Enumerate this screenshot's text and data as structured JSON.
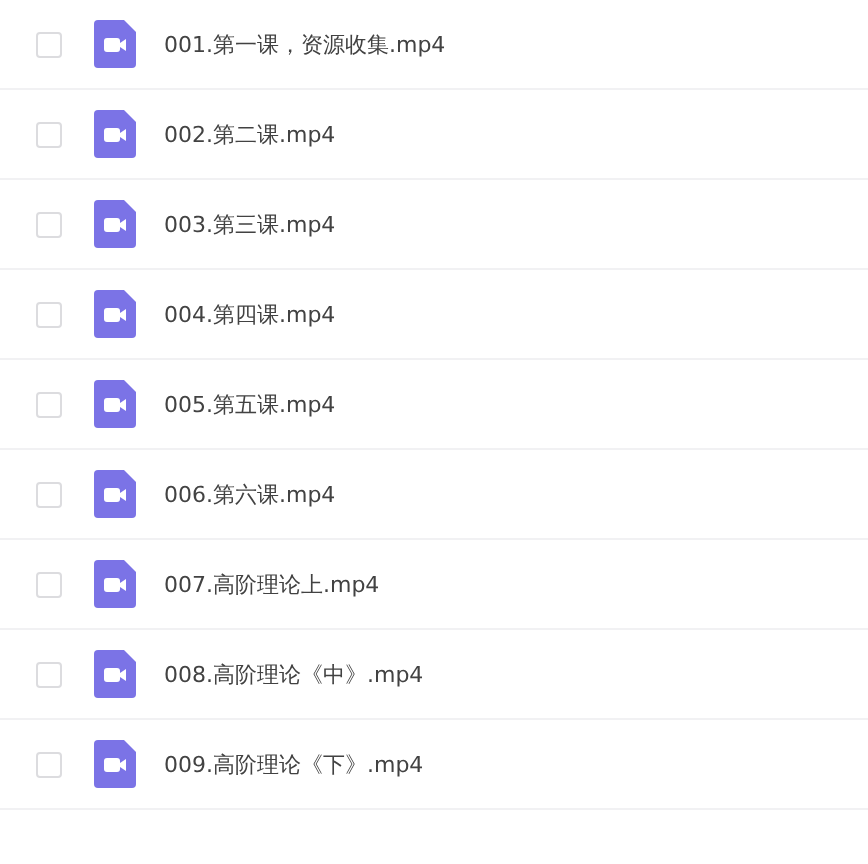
{
  "files": [
    {
      "name": "001.第一课，资源收集.mp4",
      "checked": false
    },
    {
      "name": "002.第二课.mp4",
      "checked": false
    },
    {
      "name": "003.第三课.mp4",
      "checked": false
    },
    {
      "name": "004.第四课.mp4",
      "checked": false
    },
    {
      "name": "005.第五课.mp4",
      "checked": false
    },
    {
      "name": "006.第六课.mp4",
      "checked": false
    },
    {
      "name": "007.高阶理论上.mp4",
      "checked": false
    },
    {
      "name": "008.高阶理论《中》.mp4",
      "checked": false
    },
    {
      "name": "009.高阶理论《下》.mp4",
      "checked": false
    }
  ]
}
